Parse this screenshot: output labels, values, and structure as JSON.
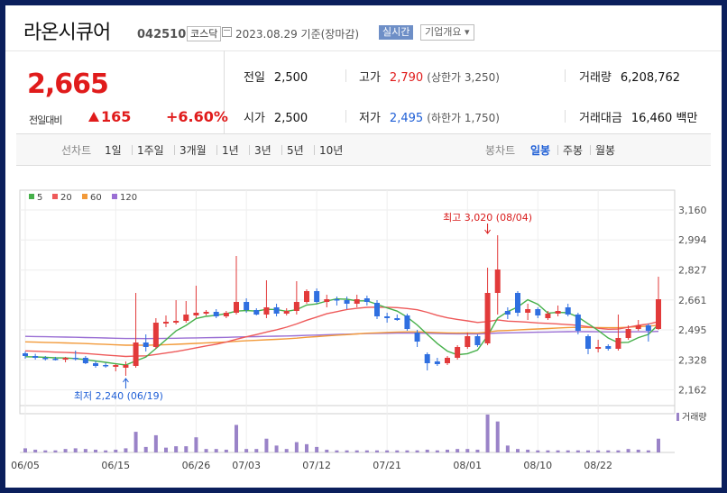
{
  "header": {
    "company": "라온시큐어",
    "code": "042510",
    "market": "코스닥",
    "date": "2023.08.29",
    "basis": "기준(장마감)",
    "realtime_label": "실시간",
    "overview_label": "기업개요",
    "overview_arrow": "▾"
  },
  "price": {
    "current": "2,665",
    "compare_label": "전일대비",
    "change": "165",
    "change_pct": "+6.60%",
    "direction": "up"
  },
  "stats": {
    "prev_close": {
      "label": "전일",
      "value": "2,500"
    },
    "open": {
      "label": "시가",
      "value": "2,500"
    },
    "high": {
      "label": "고가",
      "value": "2,790",
      "sub": "(상한가 3,250)"
    },
    "low": {
      "label": "저가",
      "value": "2,495",
      "sub": "(하한가 1,750)"
    },
    "volume": {
      "label": "거래량",
      "value": "6,208,762"
    },
    "amount": {
      "label": "거래대금",
      "value": "16,460",
      "unit": "백만"
    }
  },
  "periods": {
    "line_label": "선차트",
    "line_items": [
      "1일",
      "1주일",
      "3개월",
      "1년",
      "3년",
      "5년",
      "10년"
    ],
    "candle_label": "봉차트",
    "candle_items": [
      "일봉",
      "주봉",
      "월봉"
    ],
    "selected": "일봉"
  },
  "colors": {
    "up": "#e23a3a",
    "down": "#2f6fe0",
    "ma5": "#46b04a",
    "ma20": "#ee5a5a",
    "ma60": "#f29a3a",
    "ma120": "#9a6fd4",
    "volume": "#9a83c8"
  },
  "chart_data": {
    "type": "candlestick",
    "legend": [
      "5",
      "20",
      "60",
      "120"
    ],
    "ylim": [
      2100,
      3200
    ],
    "yticks": [
      "3,160",
      "2,994",
      "2,827",
      "2,661",
      "2,495",
      "2,328",
      "2,162"
    ],
    "xticks": [
      {
        "index": 0,
        "label": "06/05"
      },
      {
        "index": 9,
        "label": "06/15"
      },
      {
        "index": 17,
        "label": "06/26"
      },
      {
        "index": 22,
        "label": "07/03"
      },
      {
        "index": 29,
        "label": "07/12"
      },
      {
        "index": 36,
        "label": "07/21"
      },
      {
        "index": 44,
        "label": "08/01"
      },
      {
        "index": 51,
        "label": "08/10"
      },
      {
        "index": 57,
        "label": "08/22"
      }
    ],
    "annotations": {
      "high": {
        "text": "최고 3,020 (08/04)",
        "index": 46,
        "value": 3020
      },
      "low": {
        "text": "최저 2,240 (06/19)",
        "index": 10,
        "value": 2240
      }
    },
    "volume_label": "거래량",
    "candles": [
      {
        "o": 2365,
        "h": 2375,
        "l": 2335,
        "c": 2350,
        "v": 6
      },
      {
        "o": 2350,
        "h": 2362,
        "l": 2330,
        "c": 2340,
        "v": 4
      },
      {
        "o": 2340,
        "h": 2350,
        "l": 2325,
        "c": 2335,
        "v": 3
      },
      {
        "o": 2335,
        "h": 2345,
        "l": 2325,
        "c": 2330,
        "v": 3
      },
      {
        "o": 2330,
        "h": 2345,
        "l": 2315,
        "c": 2340,
        "v": 5
      },
      {
        "o": 2340,
        "h": 2380,
        "l": 2325,
        "c": 2335,
        "v": 6
      },
      {
        "o": 2340,
        "h": 2350,
        "l": 2305,
        "c": 2310,
        "v": 5
      },
      {
        "o": 2310,
        "h": 2322,
        "l": 2285,
        "c": 2295,
        "v": 4
      },
      {
        "o": 2300,
        "h": 2312,
        "l": 2285,
        "c": 2295,
        "v": 3
      },
      {
        "o": 2290,
        "h": 2305,
        "l": 2265,
        "c": 2300,
        "v": 4
      },
      {
        "o": 2285,
        "h": 2320,
        "l": 2240,
        "c": 2300,
        "v": 6
      },
      {
        "o": 2295,
        "h": 2700,
        "l": 2285,
        "c": 2425,
        "v": 30
      },
      {
        "o": 2425,
        "h": 2470,
        "l": 2375,
        "c": 2400,
        "v": 8
      },
      {
        "o": 2400,
        "h": 2560,
        "l": 2390,
        "c": 2535,
        "v": 25
      },
      {
        "o": 2530,
        "h": 2575,
        "l": 2510,
        "c": 2540,
        "v": 7
      },
      {
        "o": 2535,
        "h": 2660,
        "l": 2525,
        "c": 2545,
        "v": 9
      },
      {
        "o": 2545,
        "h": 2655,
        "l": 2535,
        "c": 2580,
        "v": 9
      },
      {
        "o": 2575,
        "h": 2740,
        "l": 2560,
        "c": 2590,
        "v": 22
      },
      {
        "o": 2585,
        "h": 2605,
        "l": 2575,
        "c": 2595,
        "v": 5
      },
      {
        "o": 2595,
        "h": 2610,
        "l": 2560,
        "c": 2570,
        "v": 5
      },
      {
        "o": 2570,
        "h": 2600,
        "l": 2560,
        "c": 2590,
        "v": 4
      },
      {
        "o": 2590,
        "h": 2905,
        "l": 2580,
        "c": 2650,
        "v": 40
      },
      {
        "o": 2650,
        "h": 2670,
        "l": 2590,
        "c": 2605,
        "v": 5
      },
      {
        "o": 2605,
        "h": 2615,
        "l": 2575,
        "c": 2580,
        "v": 5
      },
      {
        "o": 2580,
        "h": 2770,
        "l": 2560,
        "c": 2620,
        "v": 20
      },
      {
        "o": 2620,
        "h": 2640,
        "l": 2570,
        "c": 2585,
        "v": 10
      },
      {
        "o": 2585,
        "h": 2615,
        "l": 2575,
        "c": 2600,
        "v": 5
      },
      {
        "o": 2600,
        "h": 2765,
        "l": 2580,
        "c": 2650,
        "v": 15
      },
      {
        "o": 2650,
        "h": 2720,
        "l": 2640,
        "c": 2710,
        "v": 12
      },
      {
        "o": 2710,
        "h": 2725,
        "l": 2640,
        "c": 2650,
        "v": 8
      },
      {
        "o": 2650,
        "h": 2690,
        "l": 2620,
        "c": 2665,
        "v": 4
      },
      {
        "o": 2665,
        "h": 2680,
        "l": 2630,
        "c": 2660,
        "v": 3
      },
      {
        "o": 2660,
        "h": 2680,
        "l": 2610,
        "c": 2640,
        "v": 3
      },
      {
        "o": 2640,
        "h": 2690,
        "l": 2620,
        "c": 2665,
        "v": 3
      },
      {
        "o": 2670,
        "h": 2685,
        "l": 2630,
        "c": 2650,
        "v": 3
      },
      {
        "o": 2645,
        "h": 2660,
        "l": 2555,
        "c": 2570,
        "v": 3
      },
      {
        "o": 2570,
        "h": 2590,
        "l": 2535,
        "c": 2560,
        "v": 3
      },
      {
        "o": 2560,
        "h": 2580,
        "l": 2545,
        "c": 2550,
        "v": 3
      },
      {
        "o": 2575,
        "h": 2585,
        "l": 2490,
        "c": 2500,
        "v": 3
      },
      {
        "o": 2480,
        "h": 2495,
        "l": 2400,
        "c": 2430,
        "v": 3
      },
      {
        "o": 2360,
        "h": 2370,
        "l": 2270,
        "c": 2310,
        "v": 4
      },
      {
        "o": 2320,
        "h": 2340,
        "l": 2295,
        "c": 2305,
        "v": 3
      },
      {
        "o": 2310,
        "h": 2350,
        "l": 2300,
        "c": 2340,
        "v": 4
      },
      {
        "o": 2340,
        "h": 2410,
        "l": 2330,
        "c": 2400,
        "v": 5
      },
      {
        "o": 2400,
        "h": 2480,
        "l": 2390,
        "c": 2460,
        "v": 5
      },
      {
        "o": 2460,
        "h": 2470,
        "l": 2400,
        "c": 2410,
        "v": 4
      },
      {
        "o": 2420,
        "h": 2840,
        "l": 2410,
        "c": 2700,
        "v": 55
      },
      {
        "o": 2700,
        "h": 3020,
        "l": 2580,
        "c": 2830,
        "v": 45
      },
      {
        "o": 2600,
        "h": 2620,
        "l": 2555,
        "c": 2580,
        "v": 10
      },
      {
        "o": 2700,
        "h": 2710,
        "l": 2570,
        "c": 2590,
        "v": 5
      },
      {
        "o": 2590,
        "h": 2640,
        "l": 2550,
        "c": 2610,
        "v": 4
      },
      {
        "o": 2610,
        "h": 2620,
        "l": 2560,
        "c": 2575,
        "v": 3
      },
      {
        "o": 2560,
        "h": 2600,
        "l": 2550,
        "c": 2585,
        "v": 3
      },
      {
        "o": 2585,
        "h": 2630,
        "l": 2570,
        "c": 2600,
        "v": 3
      },
      {
        "o": 2620,
        "h": 2640,
        "l": 2570,
        "c": 2580,
        "v": 3
      },
      {
        "o": 2580,
        "h": 2590,
        "l": 2470,
        "c": 2490,
        "v": 3
      },
      {
        "o": 2460,
        "h": 2470,
        "l": 2360,
        "c": 2390,
        "v": 3
      },
      {
        "o": 2390,
        "h": 2440,
        "l": 2370,
        "c": 2400,
        "v": 3
      },
      {
        "o": 2405,
        "h": 2415,
        "l": 2380,
        "c": 2390,
        "v": 3
      },
      {
        "o": 2390,
        "h": 2580,
        "l": 2380,
        "c": 2450,
        "v": 3
      },
      {
        "o": 2450,
        "h": 2520,
        "l": 2440,
        "c": 2500,
        "v": 5
      },
      {
        "o": 2500,
        "h": 2550,
        "l": 2490,
        "c": 2520,
        "v": 4
      },
      {
        "o": 2520,
        "h": 2530,
        "l": 2430,
        "c": 2490,
        "v": 3
      },
      {
        "o": 2500,
        "h": 2790,
        "l": 2495,
        "c": 2665,
        "v": 20
      }
    ]
  }
}
